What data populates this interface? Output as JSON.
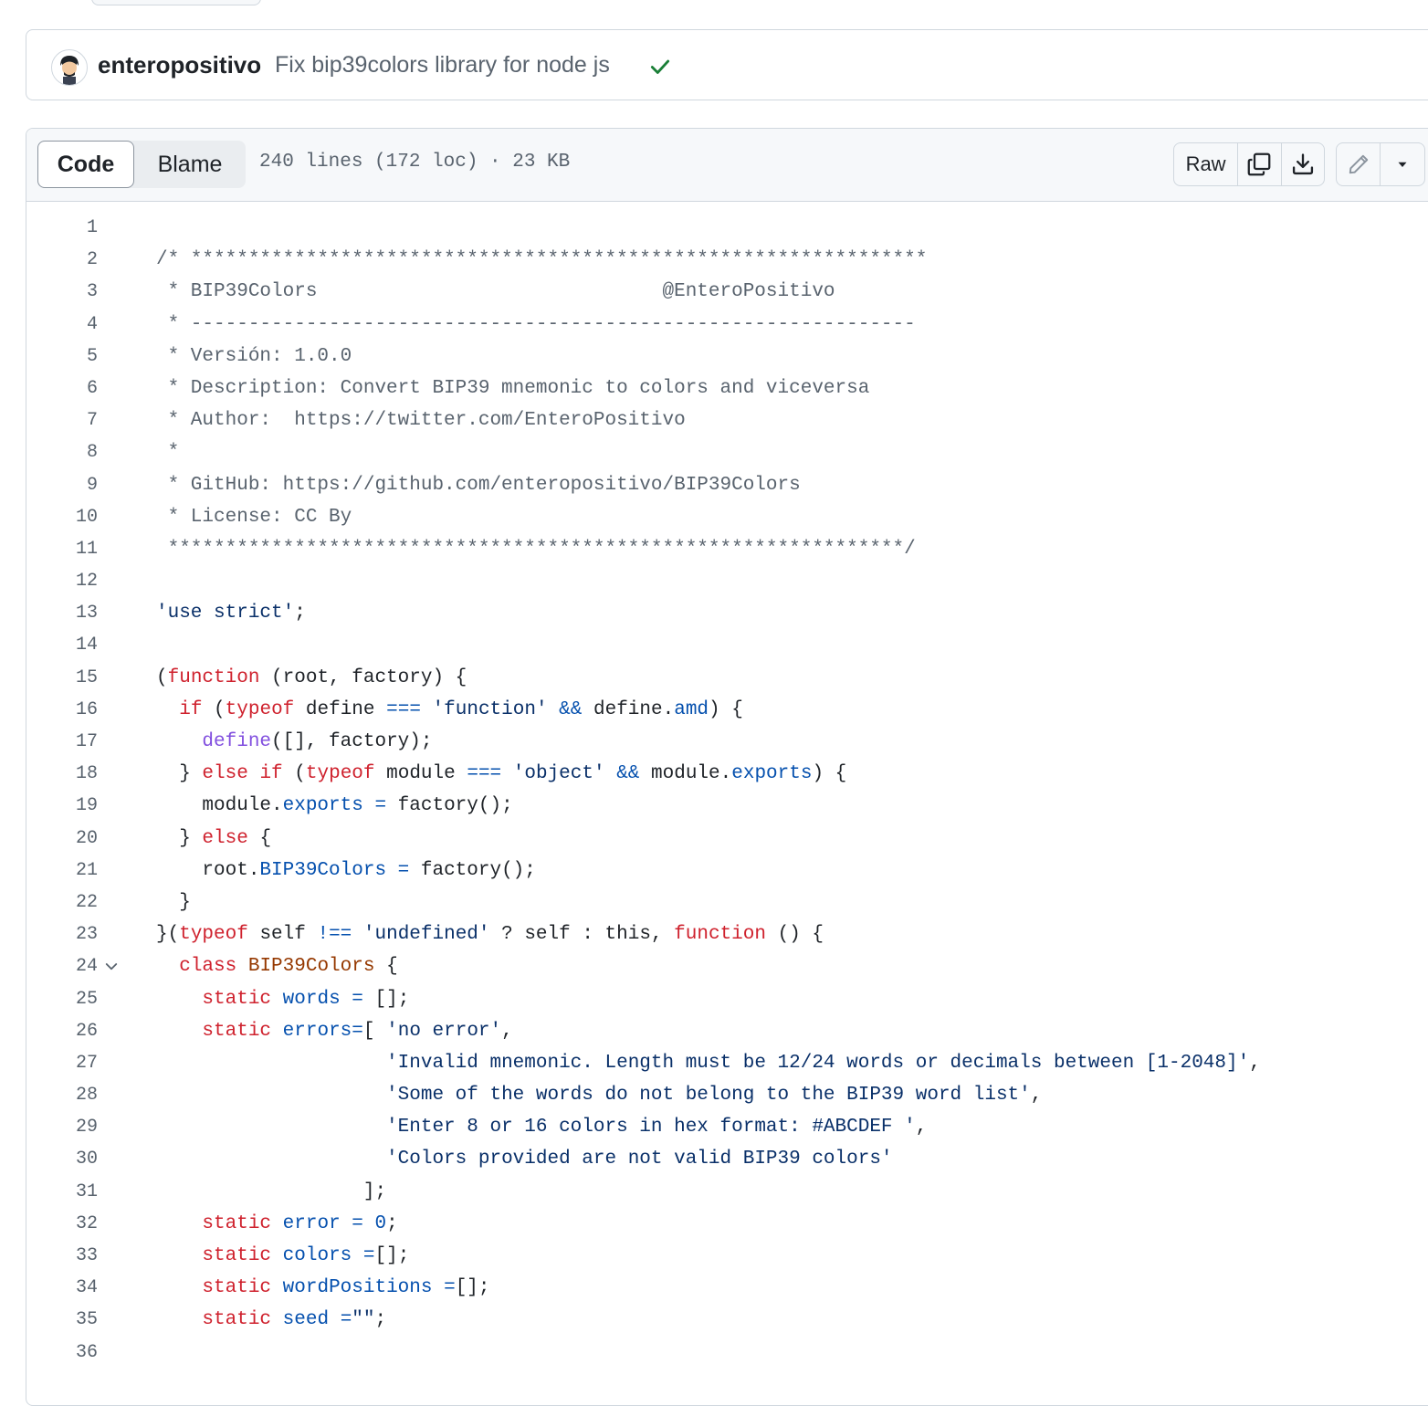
{
  "commit": {
    "author": "enteropositivo",
    "message": "Fix bip39colors library for node js",
    "status_icon": "check-icon"
  },
  "file_header": {
    "tabs": [
      {
        "label": "Code",
        "active": true
      },
      {
        "label": "Blame",
        "active": false
      }
    ],
    "meta": "240 lines (172 loc) · 23 KB",
    "raw_label": "Raw",
    "icons": [
      "copy-icon",
      "download-icon",
      "pencil-icon",
      "caret-down-icon"
    ]
  },
  "colors": {
    "keyword": "#cf222e",
    "string": "#0a3069",
    "property": "#0550ae",
    "function": "#8250df",
    "class": "#953800",
    "comment": "#59636e",
    "success": "#1a7f37"
  },
  "code_lines": [
    {
      "n": "1",
      "fold": false,
      "tokens": []
    },
    {
      "n": "2",
      "fold": false,
      "tokens": [
        [
          "cm",
          "/* ****************************************************************"
        ]
      ]
    },
    {
      "n": "3",
      "fold": false,
      "tokens": [
        [
          "cm",
          " * BIP39Colors                              @EnteroPositivo"
        ]
      ]
    },
    {
      "n": "4",
      "fold": false,
      "tokens": [
        [
          "cm",
          " * ---------------------------------------------------------------"
        ]
      ]
    },
    {
      "n": "5",
      "fold": false,
      "tokens": [
        [
          "cm",
          " * Versión: 1.0.0"
        ]
      ]
    },
    {
      "n": "6",
      "fold": false,
      "tokens": [
        [
          "cm",
          " * Description: Convert BIP39 mnemonic to colors and viceversa"
        ]
      ]
    },
    {
      "n": "7",
      "fold": false,
      "tokens": [
        [
          "cm",
          " * Author:  https://twitter.com/EnteroPositivo"
        ]
      ]
    },
    {
      "n": "8",
      "fold": false,
      "tokens": [
        [
          "cm",
          " *"
        ]
      ]
    },
    {
      "n": "9",
      "fold": false,
      "tokens": [
        [
          "cm",
          " * GitHub: https://github.com/enteropositivo/BIP39Colors"
        ]
      ]
    },
    {
      "n": "10",
      "fold": false,
      "tokens": [
        [
          "cm",
          " * License: CC By"
        ]
      ]
    },
    {
      "n": "11",
      "fold": false,
      "tokens": [
        [
          "cm",
          " ****************************************************************/"
        ]
      ]
    },
    {
      "n": "12",
      "fold": false,
      "tokens": []
    },
    {
      "n": "13",
      "fold": false,
      "tokens": [
        [
          "str",
          "'use strict'"
        ],
        [
          "",
          ";"
        ]
      ]
    },
    {
      "n": "14",
      "fold": false,
      "tokens": []
    },
    {
      "n": "15",
      "fold": false,
      "tokens": [
        [
          "",
          "("
        ],
        [
          "kw",
          "function"
        ],
        [
          "",
          " (root, factory) {"
        ]
      ]
    },
    {
      "n": "16",
      "fold": false,
      "tokens": [
        [
          "",
          "  "
        ],
        [
          "kw",
          "if"
        ],
        [
          "",
          " ("
        ],
        [
          "kw",
          "typeof"
        ],
        [
          "",
          " define "
        ],
        [
          "prop",
          "==="
        ],
        [
          "",
          " "
        ],
        [
          "str",
          "'function'"
        ],
        [
          "",
          " "
        ],
        [
          "prop",
          "&&"
        ],
        [
          "",
          " define."
        ],
        [
          "prop",
          "amd"
        ],
        [
          "",
          ") {"
        ]
      ]
    },
    {
      "n": "17",
      "fold": false,
      "tokens": [
        [
          "",
          "    "
        ],
        [
          "fn",
          "define"
        ],
        [
          "",
          "([], factory);"
        ]
      ]
    },
    {
      "n": "18",
      "fold": false,
      "tokens": [
        [
          "",
          "  } "
        ],
        [
          "kw",
          "else"
        ],
        [
          "",
          " "
        ],
        [
          "kw",
          "if"
        ],
        [
          "",
          " ("
        ],
        [
          "kw",
          "typeof"
        ],
        [
          "",
          " module "
        ],
        [
          "prop",
          "==="
        ],
        [
          "",
          " "
        ],
        [
          "str",
          "'object'"
        ],
        [
          "",
          " "
        ],
        [
          "prop",
          "&&"
        ],
        [
          "",
          " module."
        ],
        [
          "prop",
          "exports"
        ],
        [
          "",
          ") {"
        ]
      ]
    },
    {
      "n": "19",
      "fold": false,
      "tokens": [
        [
          "",
          "    module."
        ],
        [
          "prop",
          "exports"
        ],
        [
          "",
          " "
        ],
        [
          "prop",
          "="
        ],
        [
          "",
          " factory();"
        ]
      ]
    },
    {
      "n": "20",
      "fold": false,
      "tokens": [
        [
          "",
          "  } "
        ],
        [
          "kw",
          "else"
        ],
        [
          "",
          " {"
        ]
      ]
    },
    {
      "n": "21",
      "fold": false,
      "tokens": [
        [
          "",
          "    root."
        ],
        [
          "prop",
          "BIP39Colors"
        ],
        [
          "",
          " "
        ],
        [
          "prop",
          "="
        ],
        [
          "",
          " factory();"
        ]
      ]
    },
    {
      "n": "22",
      "fold": false,
      "tokens": [
        [
          "",
          "  }"
        ]
      ]
    },
    {
      "n": "23",
      "fold": false,
      "tokens": [
        [
          "",
          "}("
        ],
        [
          "kw",
          "typeof"
        ],
        [
          "",
          " self "
        ],
        [
          "prop",
          "!=="
        ],
        [
          "",
          " "
        ],
        [
          "str",
          "'undefined'"
        ],
        [
          "",
          " ? self : this, "
        ],
        [
          "kw",
          "function"
        ],
        [
          "",
          " () {"
        ]
      ]
    },
    {
      "n": "24",
      "fold": true,
      "tokens": [
        [
          "",
          "  "
        ],
        [
          "kw",
          "class"
        ],
        [
          "",
          " "
        ],
        [
          "cls",
          "BIP39Colors"
        ],
        [
          "",
          " {"
        ]
      ]
    },
    {
      "n": "25",
      "fold": false,
      "tokens": [
        [
          "",
          "    "
        ],
        [
          "kw",
          "static"
        ],
        [
          "",
          " "
        ],
        [
          "prop",
          "words"
        ],
        [
          "",
          " "
        ],
        [
          "prop",
          "="
        ],
        [
          "",
          " [];"
        ]
      ]
    },
    {
      "n": "26",
      "fold": false,
      "tokens": [
        [
          "",
          "    "
        ],
        [
          "kw",
          "static"
        ],
        [
          "",
          " "
        ],
        [
          "prop",
          "errors"
        ],
        [
          "prop",
          "="
        ],
        [
          "",
          "[ "
        ],
        [
          "str",
          "'no error'"
        ],
        [
          "",
          ","
        ]
      ]
    },
    {
      "n": "27",
      "fold": false,
      "tokens": [
        [
          "",
          "                    "
        ],
        [
          "str",
          "'Invalid mnemonic. Length must be 12/24 words or decimals between [1-2048]'"
        ],
        [
          "",
          ","
        ]
      ]
    },
    {
      "n": "28",
      "fold": false,
      "tokens": [
        [
          "",
          "                    "
        ],
        [
          "str",
          "'Some of the words do not belong to the BIP39 word list'"
        ],
        [
          "",
          ","
        ]
      ]
    },
    {
      "n": "29",
      "fold": false,
      "tokens": [
        [
          "",
          "                    "
        ],
        [
          "str",
          "'Enter 8 or 16 colors in hex format: #ABCDEF '"
        ],
        [
          "",
          ","
        ]
      ]
    },
    {
      "n": "30",
      "fold": false,
      "tokens": [
        [
          "",
          "                    "
        ],
        [
          "str",
          "'Colors provided are not valid BIP39 colors'"
        ]
      ]
    },
    {
      "n": "31",
      "fold": false,
      "tokens": [
        [
          "",
          "                  ];"
        ]
      ]
    },
    {
      "n": "32",
      "fold": false,
      "tokens": [
        [
          "",
          "    "
        ],
        [
          "kw",
          "static"
        ],
        [
          "",
          " "
        ],
        [
          "prop",
          "error"
        ],
        [
          "",
          " "
        ],
        [
          "prop",
          "="
        ],
        [
          "",
          " "
        ],
        [
          "prop",
          "0"
        ],
        [
          "",
          ";"
        ]
      ]
    },
    {
      "n": "33",
      "fold": false,
      "tokens": [
        [
          "",
          "    "
        ],
        [
          "kw",
          "static"
        ],
        [
          "",
          " "
        ],
        [
          "prop",
          "colors"
        ],
        [
          "",
          " "
        ],
        [
          "prop",
          "="
        ],
        [
          "",
          "[];"
        ]
      ]
    },
    {
      "n": "34",
      "fold": false,
      "tokens": [
        [
          "",
          "    "
        ],
        [
          "kw",
          "static"
        ],
        [
          "",
          " "
        ],
        [
          "prop",
          "wordPositions"
        ],
        [
          "",
          " "
        ],
        [
          "prop",
          "="
        ],
        [
          "",
          "[];"
        ]
      ]
    },
    {
      "n": "35",
      "fold": false,
      "tokens": [
        [
          "",
          "    "
        ],
        [
          "kw",
          "static"
        ],
        [
          "",
          " "
        ],
        [
          "prop",
          "seed"
        ],
        [
          "",
          " "
        ],
        [
          "prop",
          "="
        ],
        [
          "str",
          "\"\""
        ],
        [
          "",
          ";"
        ]
      ]
    },
    {
      "n": "36",
      "fold": false,
      "tokens": []
    }
  ]
}
